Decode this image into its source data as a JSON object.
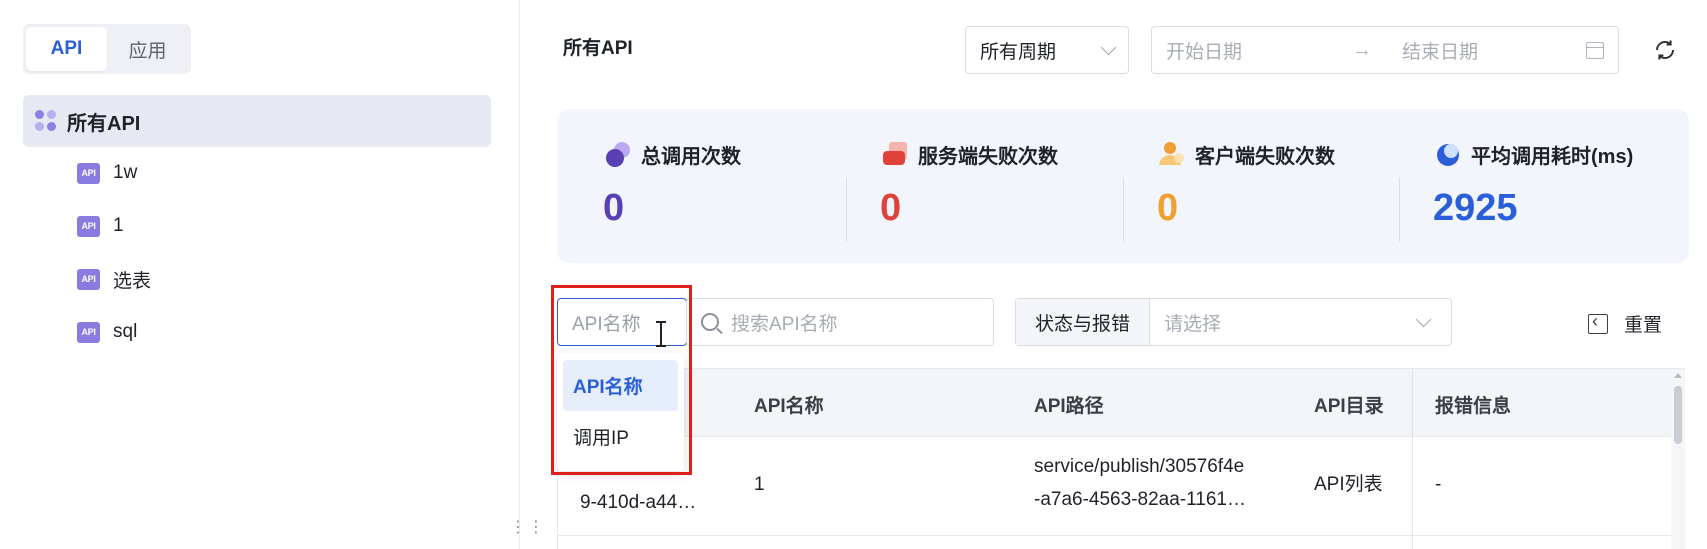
{
  "sidebar": {
    "tabs": [
      {
        "label": "API",
        "active": true
      },
      {
        "label": "应用",
        "active": false
      }
    ],
    "root_item": {
      "label": "所有API",
      "icon": "grid-icon"
    },
    "items": [
      {
        "label": "1w",
        "badge": "API"
      },
      {
        "label": "1",
        "badge": "API"
      },
      {
        "label": "选表",
        "badge": "API"
      },
      {
        "label": "sql",
        "badge": "API"
      }
    ]
  },
  "header": {
    "title": "所有API",
    "period_select": {
      "value": "所有周期"
    },
    "date_range": {
      "start_placeholder": "开始日期",
      "arrow": "→",
      "end_placeholder": "结束日期"
    }
  },
  "stats": [
    {
      "label": "总调用次数",
      "value": "0",
      "color": "#5b3fb5",
      "icon": "total-calls-icon"
    },
    {
      "label": "服务端失败次数",
      "value": "0",
      "color": "#e0423a",
      "icon": "server-fail-icon"
    },
    {
      "label": "客户端失败次数",
      "value": "0",
      "color": "#f0a030",
      "icon": "client-fail-icon"
    },
    {
      "label": "平均调用耗时(ms)",
      "value": "2925",
      "color": "#2b5fd9",
      "icon": "avg-time-icon"
    }
  ],
  "filters": {
    "search_type": {
      "placeholder": "API名称"
    },
    "search": {
      "placeholder": "搜索API名称"
    },
    "status": {
      "label": "状态与报错",
      "placeholder": "请选择"
    },
    "reset_label": "重置"
  },
  "dropdown": {
    "options": [
      {
        "label": "API名称",
        "selected": true
      },
      {
        "label": "调用IP",
        "selected": false
      }
    ]
  },
  "table": {
    "columns": [
      "API名称",
      "API路径",
      "API目录",
      "报错信息"
    ],
    "rows": [
      {
        "id_line1": "9-410d-a44…",
        "name": "1",
        "path_line1": "service/publish/30576f4e",
        "path_line2": "-a7a6-4563-82aa-1161…",
        "directory": "API列表",
        "error": "-"
      }
    ]
  },
  "colors": {
    "accent": "#2b5fd9",
    "highlight": "#e0201c"
  }
}
